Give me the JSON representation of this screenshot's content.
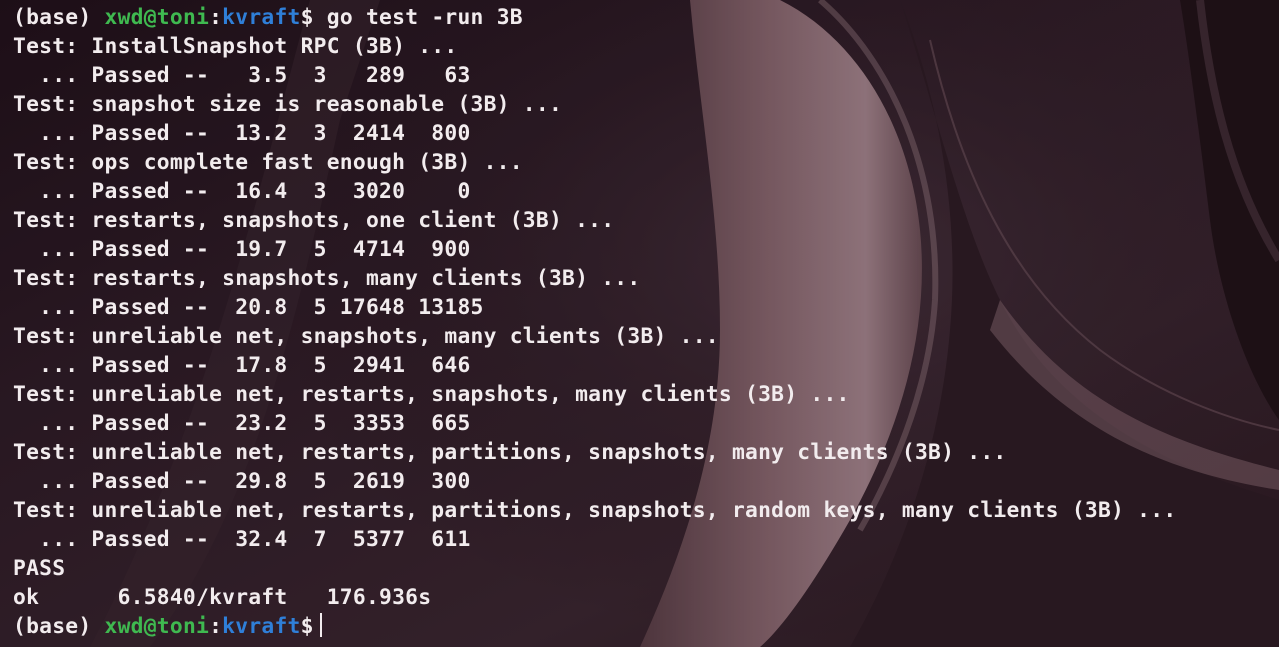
{
  "terminal": {
    "prompt": {
      "env": "(base)",
      "user_host": "xwd@toni",
      "separator": ":",
      "path": "kvraft",
      "symbol": "$"
    },
    "command": "go test -run 3B",
    "output_lines": [
      "Test: InstallSnapshot RPC (3B) ...",
      "  ... Passed --   3.5  3   289   63",
      "Test: snapshot size is reasonable (3B) ...",
      "  ... Passed --  13.2  3  2414  800",
      "Test: ops complete fast enough (3B) ...",
      "  ... Passed --  16.4  3  3020    0",
      "Test: restarts, snapshots, one client (3B) ...",
      "  ... Passed --  19.7  5  4714  900",
      "Test: restarts, snapshots, many clients (3B) ...",
      "  ... Passed --  20.8  5 17648 13185",
      "Test: unreliable net, snapshots, many clients (3B) ...",
      "  ... Passed --  17.8  5  2941  646",
      "Test: unreliable net, restarts, snapshots, many clients (3B) ...",
      "  ... Passed --  23.2  5  3353  665",
      "Test: unreliable net, restarts, partitions, snapshots, many clients (3B) ...",
      "  ... Passed --  29.8  5  2619  300",
      "Test: unreliable net, restarts, partitions, snapshots, random keys, many clients (3B) ...",
      "  ... Passed --  32.4  7  5377  611",
      "PASS",
      "ok      6.5840/kvraft   176.936s"
    ]
  },
  "colors": {
    "background": "#2a1a25",
    "text": "#f2ecee",
    "user_host": "#3fb950",
    "path": "#2f7fd8"
  }
}
